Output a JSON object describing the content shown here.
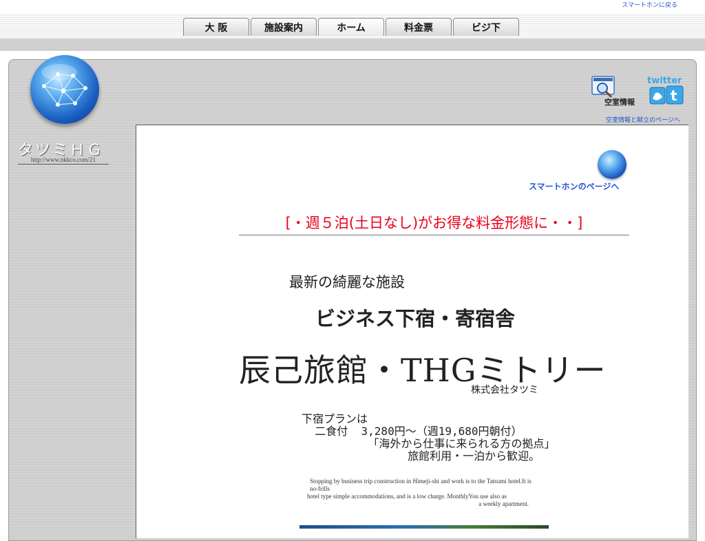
{
  "header": {
    "smartphone_return_link": "スマートホンに戻る"
  },
  "nav": {
    "tabs": [
      {
        "label": "大 阪",
        "active": false
      },
      {
        "label": "施設案内",
        "active": false
      },
      {
        "label": "ホーム",
        "active": true
      },
      {
        "label": "料金票",
        "active": false
      },
      {
        "label": "ビジ下",
        "active": false
      }
    ]
  },
  "sidebar": {
    "site_name": "タツミＨＧ",
    "site_url": "http://www.nkkco.com/21"
  },
  "topright": {
    "vacancy_icon_label": "空室情報",
    "twitter_label": "twitter",
    "vacancy_link": "空室情報と献立のページへ"
  },
  "main": {
    "smartphone_page_link": "スマートホンのページへ",
    "headline": "[・週５泊(土日なし)がお得な料金形態に・・]",
    "tagline_1": "最新の綺麗な施設",
    "tagline_2": "ビジネス下宿・寄宿舎",
    "title": "辰己旅館・THGミトリー",
    "company": "株式会社タツミ",
    "plan": {
      "line1": "下宿プランは",
      "line2": "  二食付  3,280円～（週19,680円朝付）",
      "line3": "          「海外から仕事に来られる方の拠点」",
      "line4": "                旅館利用・一泊から歓迎。"
    },
    "english": {
      "line1": "Stopping by business trip construction in Himeji-shi and work is to the Tatsumi hotel.It is no-frills",
      "line3": "hotel type simple accommodations, and is a low charge. MonthlyYou use also as",
      "line4": "a weekly apartment."
    }
  },
  "colors": {
    "link": "#2255cc",
    "headline": "#e8001c",
    "globe": "#1a5fc2"
  }
}
